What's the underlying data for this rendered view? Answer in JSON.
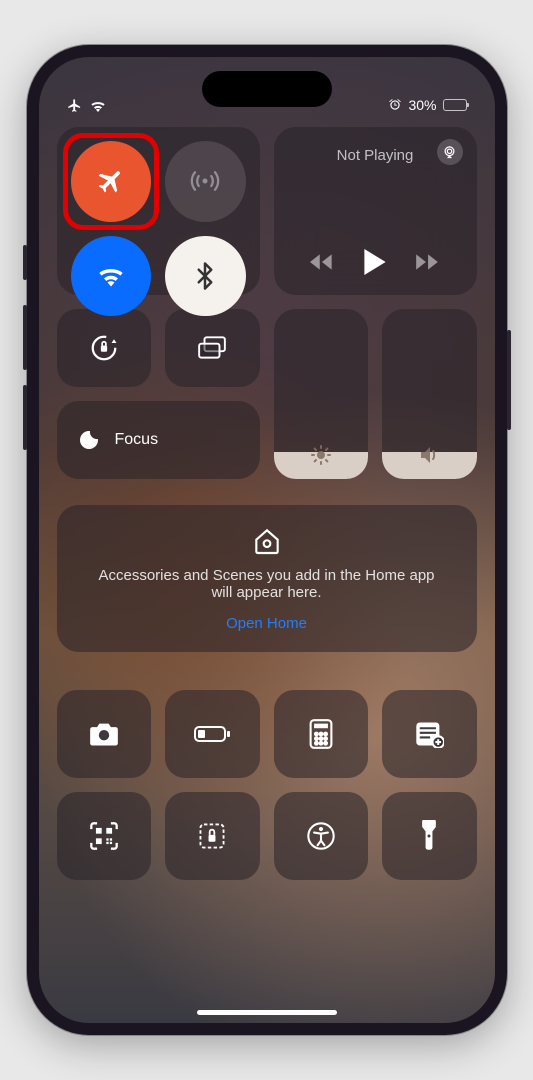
{
  "status": {
    "alarm_icon": "alarm-icon",
    "battery_percent": "30%",
    "battery_level": 0.3
  },
  "connectivity": {
    "airplane_on": true,
    "cellular_on": false,
    "wifi_on": true,
    "bluetooth_on": true
  },
  "media": {
    "now_playing": "Not Playing"
  },
  "focus": {
    "label": "Focus"
  },
  "brightness": {
    "level": 0.16
  },
  "volume": {
    "level": 0.16
  },
  "home": {
    "message": "Accessories and Scenes you add in the Home app will appear here.",
    "link": "Open Home"
  },
  "shortcuts": {
    "row1": [
      "camera",
      "low-power",
      "calculator",
      "notes"
    ],
    "row2": [
      "qr-scanner",
      "lock-rotation",
      "accessibility",
      "flashlight"
    ]
  },
  "colors": {
    "airplane": "#e8552e",
    "wifi": "#0a6cff",
    "link": "#1f7fff",
    "annotation": "#e30000"
  }
}
